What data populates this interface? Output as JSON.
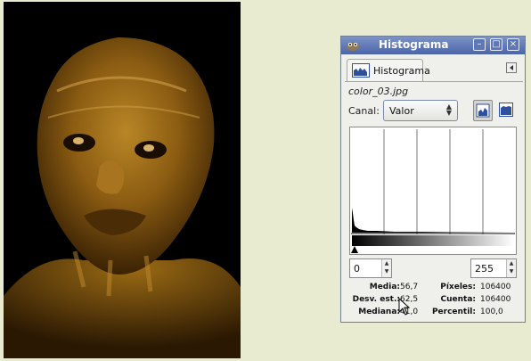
{
  "window": {
    "title": "Histograma"
  },
  "tab": {
    "label": "Histograma"
  },
  "image_name": "color_03.jpg",
  "channel": {
    "label": "Canal:",
    "value": "Valor"
  },
  "range": {
    "low": "0",
    "high": "255"
  },
  "stats": {
    "media_label": "Media:",
    "media_value": "56,7",
    "desv_label": "Desv. est.:",
    "desv_value": "62,5",
    "mediana_label": "Mediana:",
    "mediana_value": "41,0",
    "pixeles_label": "Píxeles:",
    "pixeles_value": "106400",
    "cuenta_label": "Cuenta:",
    "cuenta_value": "106400",
    "percentil_label": "Percentil:",
    "percentil_value": "100,0"
  },
  "colors": {
    "titlebar": "#5a72b2",
    "photo_tone": "#9a6a14",
    "desktop": "#e8ebd0"
  },
  "icons": [
    "gimp-logo-icon",
    "histogram-tab-icon",
    "tab-menu-icon",
    "minimize-icon",
    "maximize-icon",
    "close-icon",
    "linear-histogram-icon",
    "log-histogram-icon",
    "mouse-cursor-icon"
  ]
}
